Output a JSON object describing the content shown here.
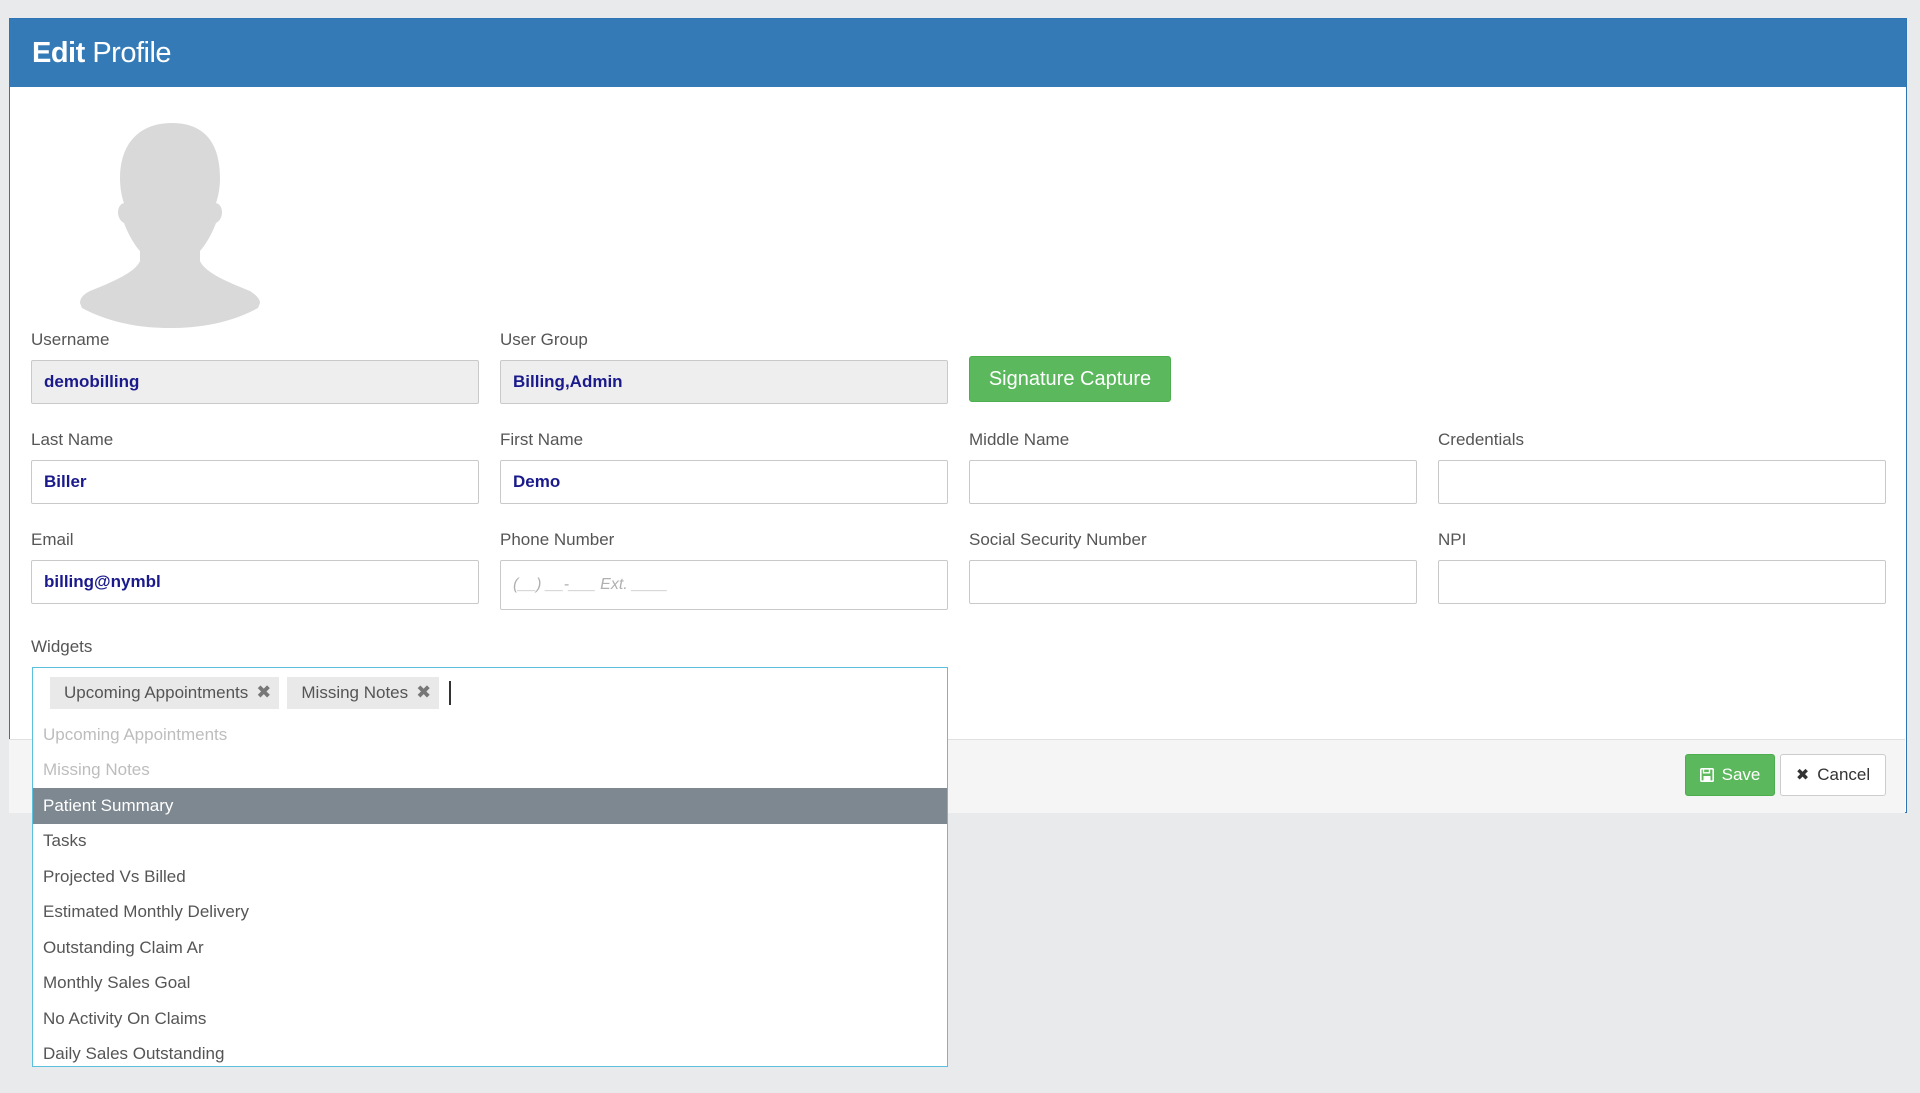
{
  "modal": {
    "title_bold": "Edit",
    "title_light": "Profile"
  },
  "fields": {
    "username": {
      "label": "Username",
      "value": "demobilling"
    },
    "user_group": {
      "label": "User Group",
      "value": "Billing,Admin"
    },
    "last_name": {
      "label": "Last Name",
      "value": "Biller"
    },
    "first_name": {
      "label": "First Name",
      "value": "Demo"
    },
    "middle_name": {
      "label": "Middle Name",
      "value": ""
    },
    "credentials": {
      "label": "Credentials",
      "value": ""
    },
    "email": {
      "label": "Email",
      "value": "billing@nymbl"
    },
    "phone": {
      "label": "Phone Number",
      "placeholder": "(__) __-___ Ext. ____"
    },
    "ssn": {
      "label": "Social Security Number",
      "value": ""
    },
    "npi": {
      "label": "NPI",
      "value": ""
    }
  },
  "signature_button": "Signature Capture",
  "widgets": {
    "label": "Widgets",
    "selected": [
      "Upcoming Appointments",
      "Missing Notes"
    ],
    "options": [
      {
        "label": "Upcoming Appointments",
        "state": "disabled"
      },
      {
        "label": "Missing Notes",
        "state": "disabled"
      },
      {
        "label": "Patient Summary",
        "state": "active"
      },
      {
        "label": "Tasks",
        "state": "normal"
      },
      {
        "label": "Projected Vs Billed",
        "state": "normal"
      },
      {
        "label": "Estimated Monthly Delivery",
        "state": "normal"
      },
      {
        "label": "Outstanding Claim Ar",
        "state": "normal"
      },
      {
        "label": "Monthly Sales Goal",
        "state": "normal"
      },
      {
        "label": "No Activity On Claims",
        "state": "normal"
      },
      {
        "label": "Daily Sales Outstanding",
        "state": "normal"
      }
    ]
  },
  "footer": {
    "save": "Save",
    "cancel": "Cancel"
  },
  "colors": {
    "header": "#337ab7",
    "success": "#5cb85c",
    "active_option": "#7d8890",
    "focus_border": "#5bc0de"
  }
}
